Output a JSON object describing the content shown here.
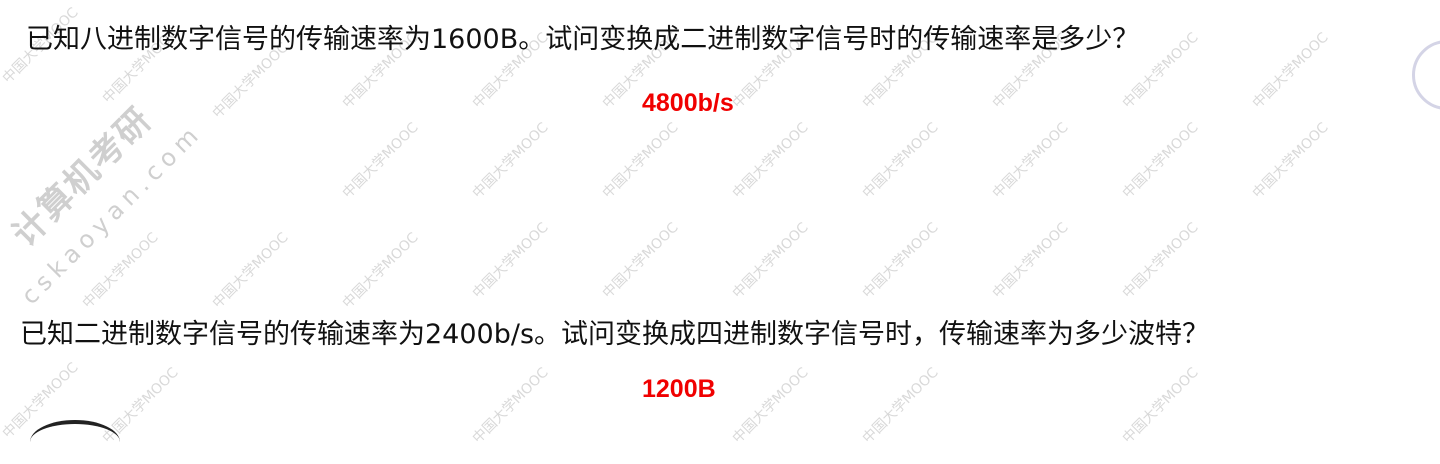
{
  "questions": [
    {
      "text": "已知八进制数字信号的传输速率为1600B。试问变换成二进制数字信号时的传输速率是多少？",
      "answer": "4800b/s"
    },
    {
      "text": "已知二进制数字信号的传输速率为2400b/s。试问变换成四进制数字信号时，传输速率为多少波特？",
      "answer": "1200B"
    }
  ],
  "watermarks": {
    "mooc": "中国大学MOOC",
    "brand": "计算机考研",
    "site": "cskaoyan.com"
  }
}
